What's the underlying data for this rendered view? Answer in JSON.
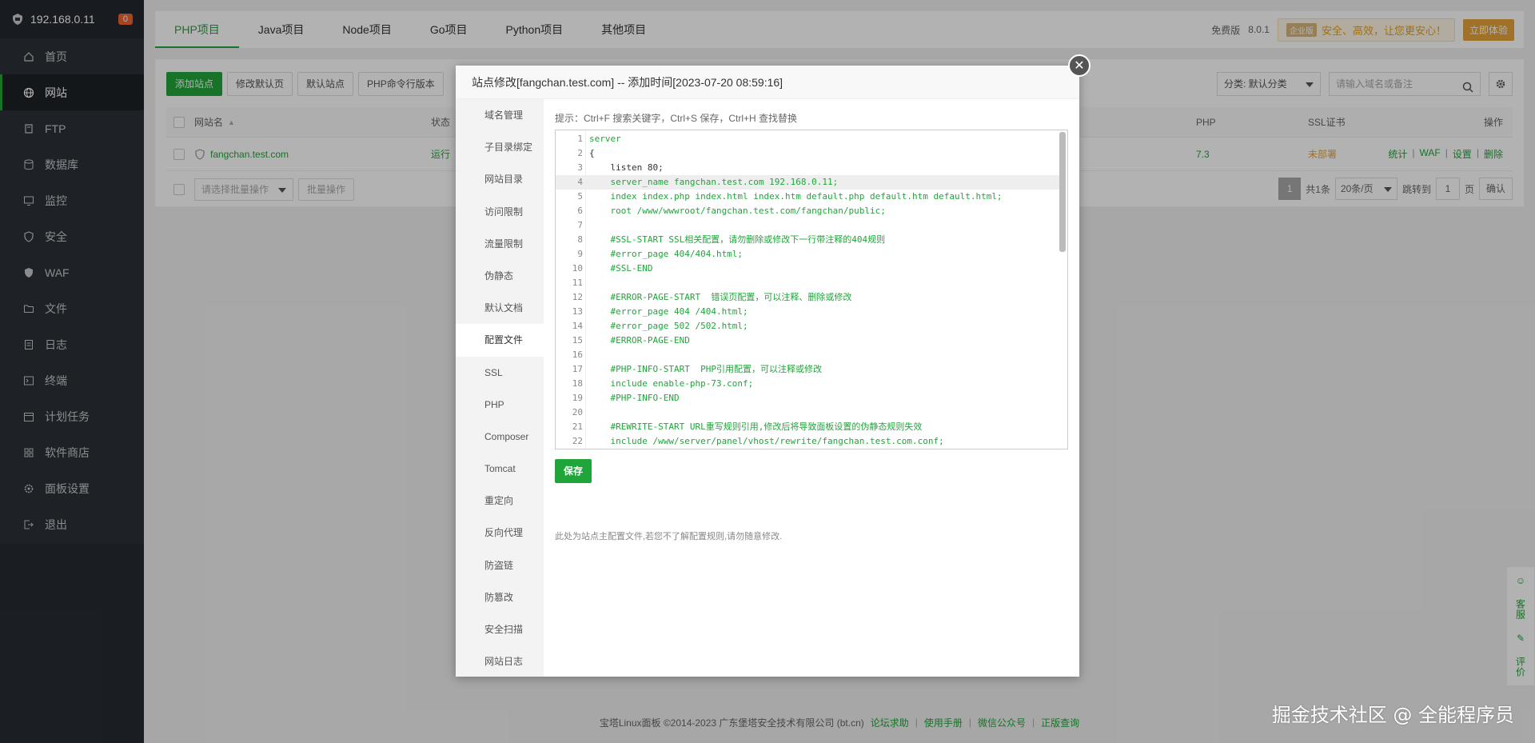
{
  "sidebar": {
    "host": "192.168.0.11",
    "badge": "0",
    "items": [
      {
        "label": "首页",
        "icon": "home-icon"
      },
      {
        "label": "网站",
        "icon": "globe-icon",
        "active": true
      },
      {
        "label": "FTP",
        "icon": "ftp-icon"
      },
      {
        "label": "数据库",
        "icon": "database-icon"
      },
      {
        "label": "监控",
        "icon": "monitor-icon"
      },
      {
        "label": "安全",
        "icon": "shield-icon"
      },
      {
        "label": "WAF",
        "icon": "waf-shield-icon"
      },
      {
        "label": "文件",
        "icon": "folder-icon"
      },
      {
        "label": "日志",
        "icon": "log-icon"
      },
      {
        "label": "终端",
        "icon": "terminal-icon"
      },
      {
        "label": "计划任务",
        "icon": "clock-icon"
      },
      {
        "label": "软件商店",
        "icon": "apps-icon"
      },
      {
        "label": "面板设置",
        "icon": "settings-icon"
      },
      {
        "label": "退出",
        "icon": "logout-icon"
      }
    ]
  },
  "topbar": {
    "tabs": [
      "PHP项目",
      "Java项目",
      "Node项目",
      "Go项目",
      "Python项目",
      "其他项目"
    ],
    "edition": "免费版",
    "version": "8.0.1",
    "pro_badge": "企业版",
    "pro_text": "安全、高效，让您更安心！",
    "upgrade": "立即体验"
  },
  "toolbar": {
    "buttons": [
      "添加站点",
      "修改默认页",
      "默认站点",
      "PHP命令行版本"
    ],
    "category": "分类: 默认分类",
    "search_placeholder": "请输入域名或备注"
  },
  "table": {
    "headers": {
      "name": "网站名",
      "status": "状态",
      "php": "PHP",
      "ssl": "SSL证书",
      "op": "操作"
    },
    "row": {
      "name": "fangchan.test.com",
      "status": "运行",
      "php": "7.3",
      "ssl": "未部署",
      "ops": [
        "统计",
        "WAF",
        "设置",
        "删除"
      ]
    },
    "batch_placeholder": "请选择批量操作",
    "batch_button": "批量操作",
    "pager": {
      "current": "1",
      "total": "共1条",
      "per_page": "20条/页",
      "goto_label": "跳转到",
      "goto_value": "1",
      "page_unit": "页",
      "confirm": "确认"
    }
  },
  "footer": {
    "copyright": "宝塔Linux面板 ©2014-2023 广东堡塔安全技术有限公司 (bt.cn)",
    "links": [
      "论坛求助",
      "使用手册",
      "微信公众号",
      "正版查询"
    ]
  },
  "float": {
    "service": "客服",
    "review": "评价"
  },
  "watermark": "掘金技术社区 @ 全能程序员",
  "modal": {
    "title": "站点修改[fangchan.test.com] -- 添加时间[2023-07-20 08:59:16]",
    "nav": [
      "域名管理",
      "子目录绑定",
      "网站目录",
      "访问限制",
      "流量限制",
      "伪静态",
      "默认文档",
      "配置文件",
      "SSL",
      "PHP",
      "Composer",
      "Tomcat",
      "重定向",
      "反向代理",
      "防盗链",
      "防篡改",
      "安全扫描",
      "网站日志"
    ],
    "active_nav": "配置文件",
    "hint": "提示：Ctrl+F 搜索关键字，Ctrl+S 保存，Ctrl+H 查找替换",
    "code_lines": [
      "server",
      "{",
      "    listen 80;",
      "    server_name fangchan.test.com 192.168.0.11;",
      "    index index.php index.html index.htm default.php default.htm default.html;",
      "    root /www/wwwroot/fangchan.test.com/fangchan/public;",
      "",
      "    #SSL-START SSL相关配置，请勿删除或修改下一行带注释的404规则",
      "    #error_page 404/404.html;",
      "    #SSL-END",
      "",
      "    #ERROR-PAGE-START  错误页配置，可以注释、删除或修改",
      "    #error_page 404 /404.html;",
      "    #error_page 502 /502.html;",
      "    #ERROR-PAGE-END",
      "",
      "    #PHP-INFO-START  PHP引用配置，可以注释或修改",
      "    include enable-php-73.conf;",
      "    #PHP-INFO-END",
      "",
      "    #REWRITE-START URL重写规则引用,修改后将导致面板设置的伪静态规则失效",
      "    include /www/server/panel/vhost/rewrite/fangchan.test.com.conf;"
    ],
    "current_line": 4,
    "save": "保存",
    "note": "此处为站点主配置文件,若您不了解配置规则,请勿随意修改."
  }
}
